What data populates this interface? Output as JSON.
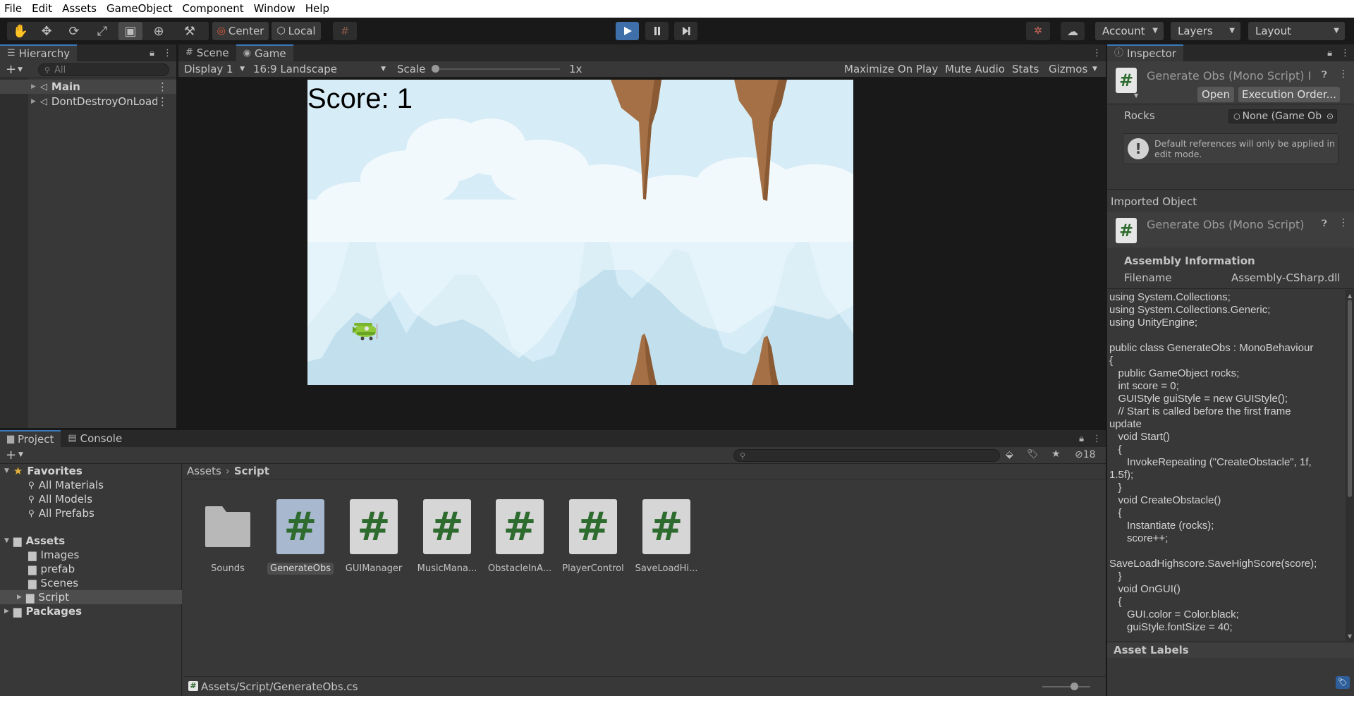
{
  "menu": [
    "File",
    "Edit",
    "Assets",
    "GameObject",
    "Component",
    "Window",
    "Help"
  ],
  "toolbar": {
    "pivot": "Center",
    "space": "Local",
    "account": "Account",
    "layers": "Layers",
    "layout": "Layout"
  },
  "hierarchy": {
    "tab": "Hierarchy",
    "search_placeholder": "All",
    "items": [
      {
        "label": "Main",
        "selected": false
      },
      {
        "label": "DontDestroyOnLoad",
        "selected": true
      }
    ]
  },
  "game_view": {
    "tabs": [
      "Scene",
      "Game"
    ],
    "display": "Display 1",
    "aspect": "16:9 Landscape",
    "scale_label": "Scale",
    "scale_value": "1x",
    "buttons": [
      "Maximize On Play",
      "Mute Audio",
      "Stats",
      "Gizmos"
    ],
    "score_text": "Score: 1"
  },
  "inspector": {
    "tab": "Inspector",
    "title": "Generate Obs (Mono Script) I",
    "open_button": "Open",
    "exec_order_button": "Execution Order...",
    "rocks_label": "Rocks",
    "rocks_value": "None (Game Ob",
    "warning": "Default references will only be applied in edit mode.",
    "imported_object": "Imported Object",
    "imported_title": "Generate Obs (Mono Script)",
    "assembly_info": "Assembly Information",
    "filename_label": "Filename",
    "filename_value": "Assembly-CSharp.dll",
    "code": "using System.Collections;\nusing System.Collections.Generic;\nusing UnityEngine;\n\npublic class GenerateObs : MonoBehaviour\n{\n   public GameObject rocks;\n   int score = 0;\n   GUIStyle guiStyle = new GUIStyle();\n   // Start is called before the first frame\nupdate\n   void Start()\n   {\n      InvokeRepeating (\"CreateObstacle\", 1f,\n1.5f);\n   }\n   void CreateObstacle()\n   {\n      Instantiate (rocks);\n      score++;\n\nSaveLoadHighscore.SaveHighScore(score);\n   }\n   void OnGUI()\n   {\n      GUI.color = Color.black;\n      guiStyle.fontSize = 40;",
    "asset_labels": "Asset Labels"
  },
  "project": {
    "tabs": [
      "Project",
      "Console"
    ],
    "hidden_count": "18",
    "breadcrumb": [
      "Assets",
      "Script"
    ],
    "favorites_label": "Favorites",
    "favorites": [
      "All Materials",
      "All Models",
      "All Prefabs"
    ],
    "assets_label": "Assets",
    "asset_folders": [
      "Images",
      "prefab",
      "Scenes",
      "Script"
    ],
    "packages_label": "Packages",
    "files": [
      {
        "name": "Sounds",
        "type": "folder"
      },
      {
        "name": "GenerateObs",
        "type": "script"
      },
      {
        "name": "GUIManager",
        "type": "script"
      },
      {
        "name": "MusicMana...",
        "type": "script"
      },
      {
        "name": "ObstacleInA...",
        "type": "script"
      },
      {
        "name": "PlayerControl",
        "type": "script"
      },
      {
        "name": "SaveLoadHi...",
        "type": "script"
      }
    ],
    "status_path": "Assets/Script/GenerateObs.cs"
  }
}
